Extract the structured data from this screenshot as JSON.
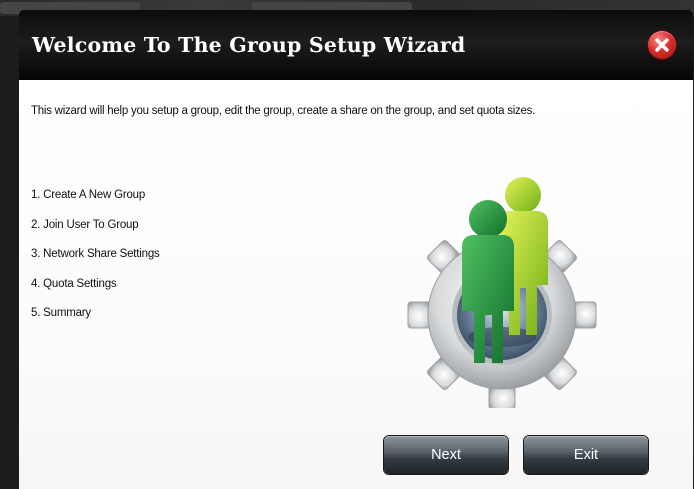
{
  "dialog": {
    "title": "Welcome To The Group Setup Wizard",
    "close_icon": "close-icon",
    "intro": "This wizard will help you setup a group, edit the group, create a share on the group, and set quota sizes.",
    "steps": [
      "1. Create A New Group",
      "2. Join User To Group",
      "3. Network Share Settings",
      "4. Quota Settings",
      "5. Summary"
    ],
    "illustration_icon": "group-users-gear-icon",
    "buttons": {
      "next": "Next",
      "exit": "Exit"
    }
  },
  "colors": {
    "titlebar": "#0b0b0b",
    "title_text": "#ffffff",
    "close_red": "#d9302f",
    "button_dark": "#343c42",
    "user_front_green": "#1f8a3a",
    "user_back_green": "#9fce1e"
  }
}
